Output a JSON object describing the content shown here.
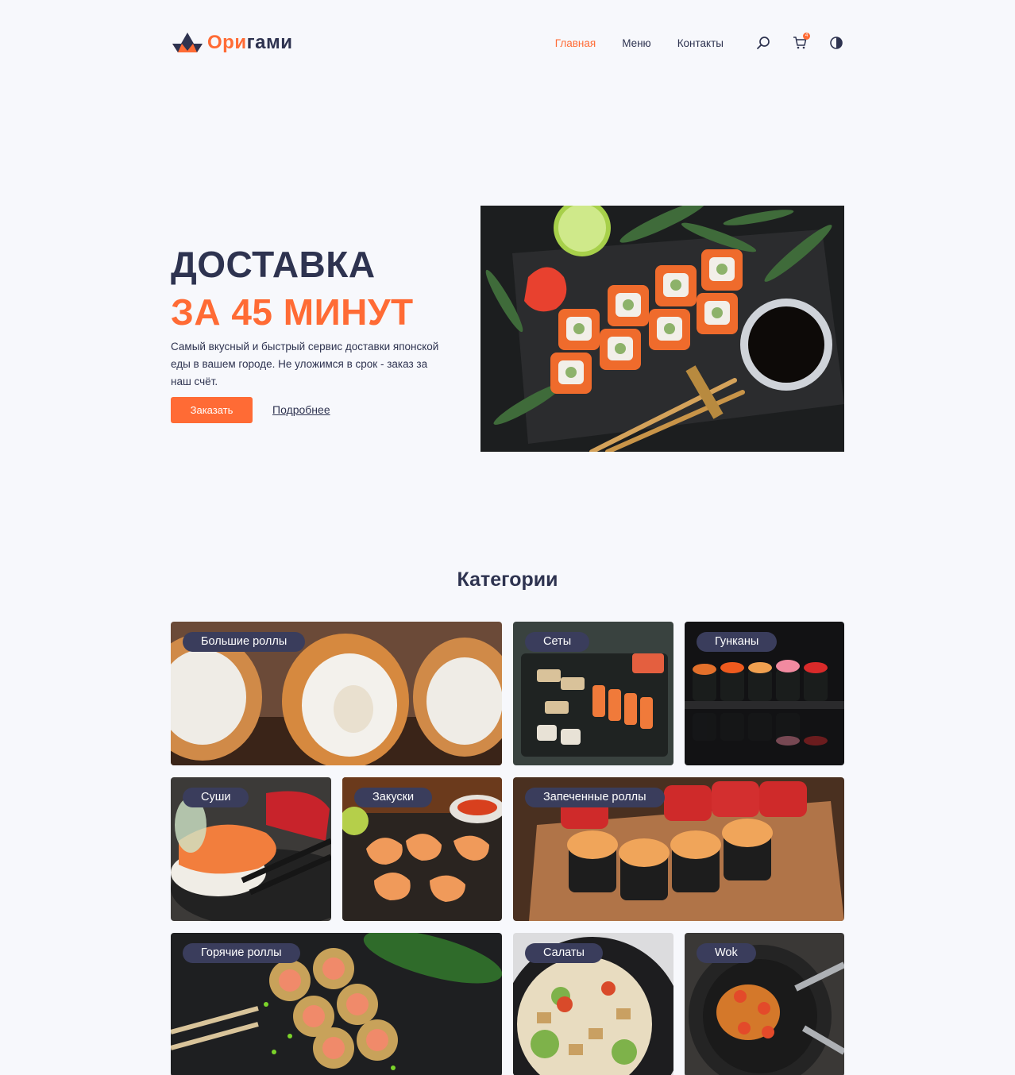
{
  "header": {
    "logo": {
      "part1": "Ори",
      "part2": "гами"
    },
    "nav": [
      "Главная",
      "Меню",
      "Контакты"
    ],
    "cart_count": "4",
    "icons": [
      "search-icon",
      "cart-icon",
      "theme-toggle-icon"
    ]
  },
  "hero": {
    "title_line1": "ДОСТАВКА",
    "title_line2": "ЗА 45 МИНУТ",
    "description": "Самый вкусный и быстрый сервис доставки японской еды в вашем городе. Не уложимся в срок - заказ за наш счёт.",
    "order_button": "Заказать",
    "more_link": "Подробнее"
  },
  "categories": {
    "title": "Категории",
    "items": [
      "Большие роллы",
      "Сеты",
      "Гунканы",
      "Суши",
      "Закуски",
      "Запеченные роллы",
      "Горячие роллы",
      "Салаты",
      "Wok"
    ]
  },
  "colors": {
    "accent": "#ff6b35",
    "dark": "#2e3350",
    "background": "#f7f8fc",
    "tag_background": "#3a3d5c"
  }
}
